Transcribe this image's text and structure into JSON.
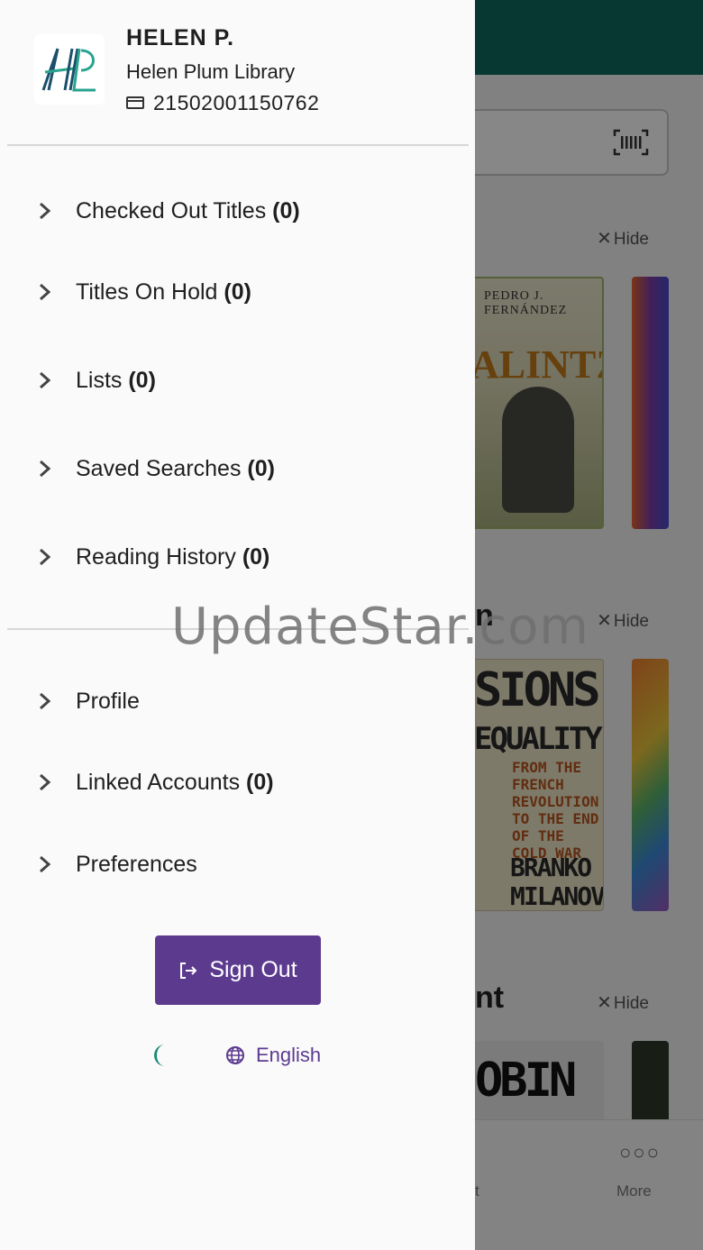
{
  "background": {
    "hide_label": "Hide",
    "section_suffix_2": "n",
    "section_suffix_3": "nt",
    "tab_partial": "t",
    "more_label": "More",
    "covers": {
      "c1_author": "PEDRO J. FERNÁNDEZ",
      "c1_title": "ALINTZIN",
      "c3_top": "SIONS",
      "c3_mid": "EQUALITY",
      "c3_sub": "FROM THE FRENCH REVOLUTION TO THE END OF THE COLD WAR",
      "c3_author": "BRANKO MILANOVIC",
      "c5_title": "OBIN"
    }
  },
  "drawer": {
    "user_name": "HELEN P.",
    "library_name": "Helen Plum Library",
    "card_number": "21502001150762",
    "menu_primary": [
      {
        "label": "Checked Out Titles",
        "count": "(0)"
      },
      {
        "label": "Titles On Hold",
        "count": "(0)"
      },
      {
        "label": "Lists",
        "count": "(0)"
      },
      {
        "label": "Saved Searches",
        "count": "(0)"
      },
      {
        "label": "Reading History",
        "count": "(0)"
      }
    ],
    "menu_secondary": [
      {
        "label": "Profile",
        "count": ""
      },
      {
        "label": "Linked Accounts",
        "count": "(0)"
      },
      {
        "label": "Preferences",
        "count": ""
      }
    ],
    "sign_out_label": "Sign Out",
    "language_label": "English"
  },
  "watermark": "UpdateStar.com",
  "colors": {
    "header_teal": "#0e6b5e",
    "primary_purple": "#5c3b8f",
    "moon_teal": "#1f8a7a"
  }
}
